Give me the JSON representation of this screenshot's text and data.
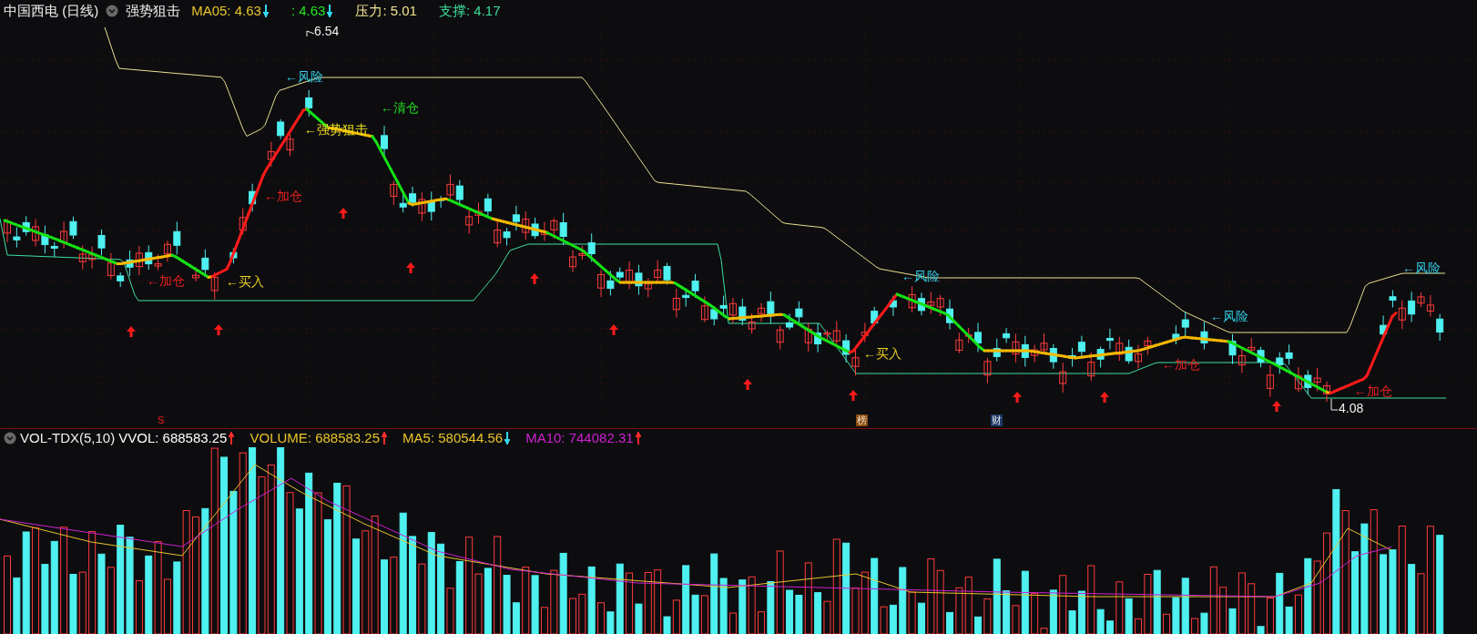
{
  "header": {
    "title": "中国西电 (日线)",
    "indicator": "强势狙击",
    "values": [
      {
        "label": "MA05: 4.63",
        "color": "#e8c32a",
        "arrow": {
          "up": false,
          "color": "#33d6ee"
        }
      },
      {
        "label": ": 4.63",
        "color": "#22e622",
        "arrow": {
          "up": false,
          "color": "#33d6ee"
        }
      },
      {
        "label": "压力: 5.01",
        "color": "#f0e08c"
      },
      {
        "label": "支撑: 4.17",
        "color": "#3ddc9a"
      }
    ]
  },
  "chart": {
    "annotations": [
      {
        "text": "6.54",
        "kind": "price"
      },
      {
        "text": "←风险",
        "kind": "risk"
      },
      {
        "text": "←清仓",
        "kind": "clear"
      },
      {
        "text": "←强势狙击",
        "kind": "strike"
      },
      {
        "text": "←加仓",
        "kind": "add"
      },
      {
        "text": "←加仓",
        "kind": "add"
      },
      {
        "text": "←买入",
        "kind": "buy"
      },
      {
        "text": "←风险",
        "kind": "risk"
      },
      {
        "text": "←买入",
        "kind": "buy"
      },
      {
        "text": "←风险",
        "kind": "risk"
      },
      {
        "text": "←加仓",
        "kind": "add"
      },
      {
        "text": "←加仓",
        "kind": "add"
      },
      {
        "text": "4.08",
        "kind": "price"
      },
      {
        "text": "←风险",
        "kind": "risk"
      }
    ]
  },
  "markers": [
    {
      "text": "S",
      "kind": "s"
    },
    {
      "text": "榜",
      "kind": "rank"
    },
    {
      "text": "财",
      "kind": "finance"
    }
  ],
  "volume": {
    "title": "VOL-TDX(5,10)",
    "values": [
      {
        "label": "VVOL: 688583.25",
        "color": "#ffffff",
        "arrow": {
          "up": true,
          "color": "#ff2a2a"
        }
      },
      {
        "label": "VOLUME: 688583.25",
        "color": "#e8c32a",
        "arrow": {
          "up": true,
          "color": "#ff2a2a"
        }
      },
      {
        "label": "MA5: 580544.56",
        "color": "#e8c32a",
        "arrow": {
          "up": false,
          "color": "#33d6ee"
        }
      },
      {
        "label": "MA10: 744082.31",
        "color": "#d020d0",
        "arrow": {
          "up": true,
          "color": "#ff2a2a"
        }
      }
    ]
  }
}
